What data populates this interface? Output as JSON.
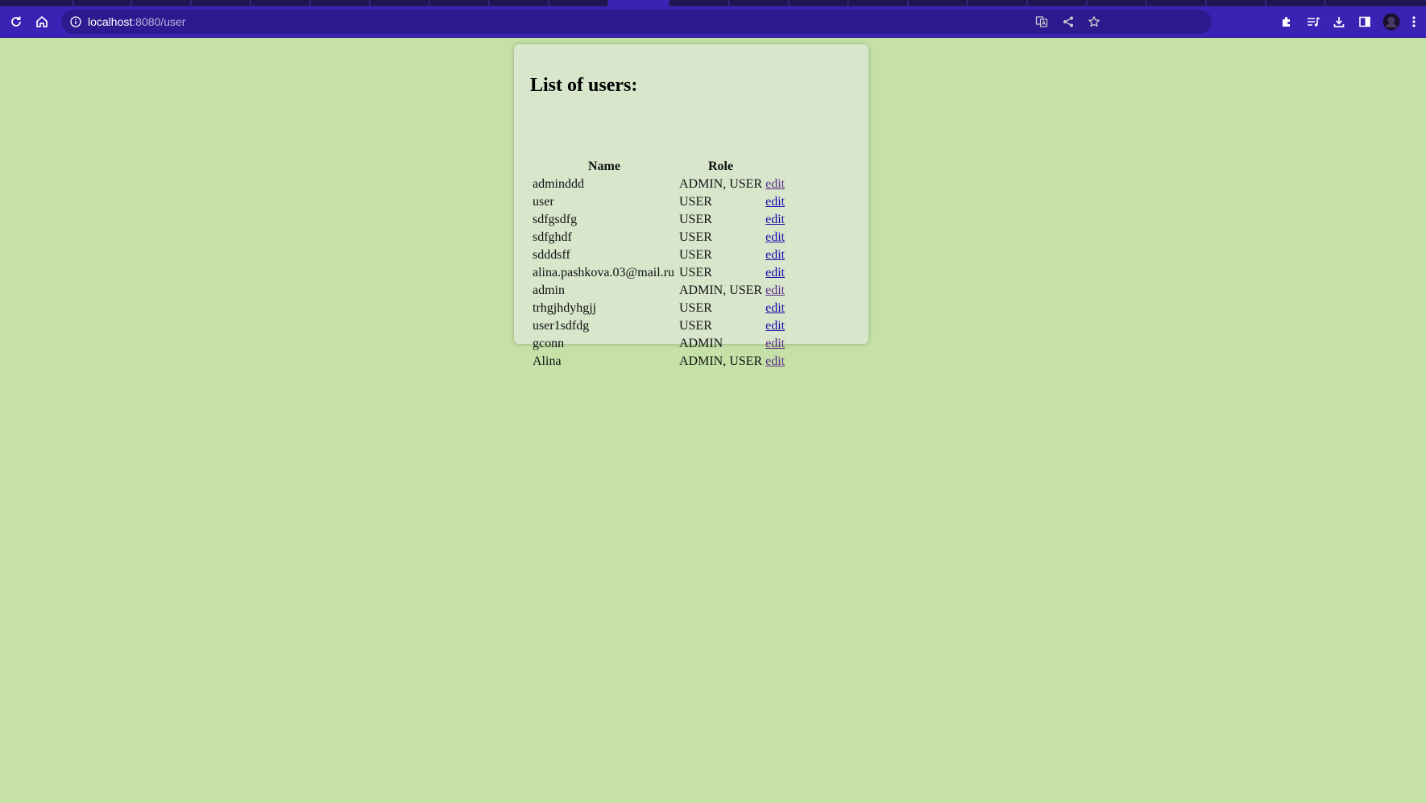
{
  "browser": {
    "url_host": "localhost",
    "url_path": ":8080/user",
    "icons": [
      "reload-icon",
      "home-icon",
      "info-icon",
      "translate-icon",
      "share-icon",
      "star-icon",
      "extensions-icon",
      "reading-list-icon",
      "download-icon",
      "side-panel-icon",
      "profile-avatar",
      "menu-icon"
    ],
    "colors": {
      "frame": "#3a23b4",
      "omnibox": "#2c1b8e"
    }
  },
  "page": {
    "heading": "List of users:",
    "columns": {
      "name": "Name",
      "role": "Role"
    },
    "edit_label": "edit",
    "users": [
      {
        "name": "adminddd",
        "role": "ADMIN, USER",
        "edit": "edit",
        "visited": true
      },
      {
        "name": "user",
        "role": "USER",
        "edit": "edit",
        "visited": false
      },
      {
        "name": "sdfgsdfg",
        "role": "USER",
        "edit": "edit",
        "visited": false
      },
      {
        "name": "sdfghdf",
        "role": "USER",
        "edit": "edit",
        "visited": false
      },
      {
        "name": "sdddsff",
        "role": "USER",
        "edit": "edit",
        "visited": false
      },
      {
        "name": "alina.pashkova.03@mail.ru",
        "role": "USER",
        "edit": "edit",
        "visited": false
      },
      {
        "name": "admin",
        "role": "ADMIN, USER",
        "edit": "edit",
        "visited": true
      },
      {
        "name": "trhgjhdyhgjj",
        "role": "USER",
        "edit": "edit",
        "visited": false
      },
      {
        "name": "user1sdfdg",
        "role": "USER",
        "edit": "edit",
        "visited": false
      },
      {
        "name": "gconn",
        "role": "ADMIN",
        "edit": "edit",
        "visited": true
      },
      {
        "name": "Alina",
        "role": "ADMIN, USER",
        "edit": "edit",
        "visited": true
      }
    ],
    "colors": {
      "background": "#c5e1a7",
      "card": "#d8e6cc",
      "link": "#1a0dab",
      "link_visited": "#5b2d86"
    }
  }
}
